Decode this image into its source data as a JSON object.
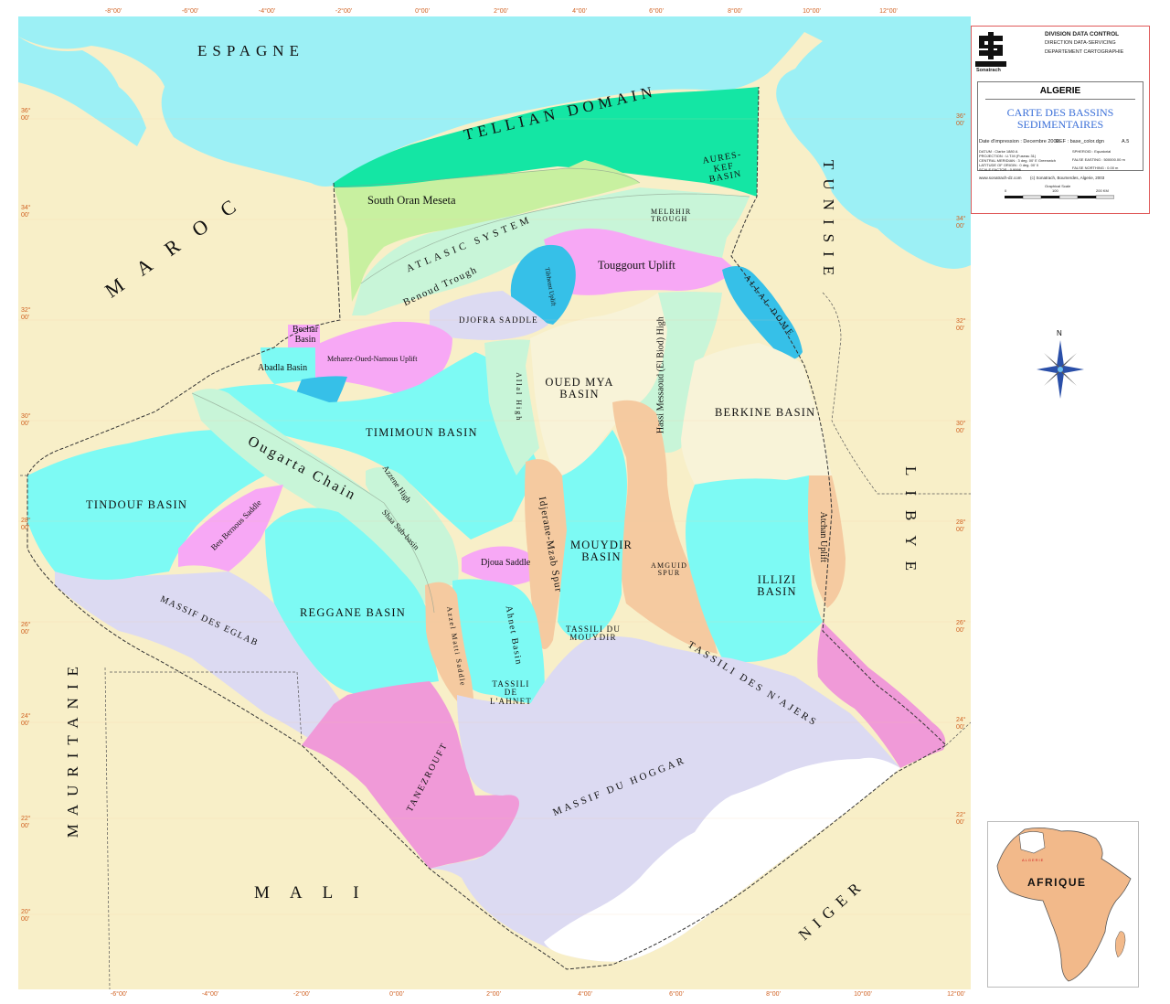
{
  "graticule": {
    "top": [
      "-8°00'",
      "-6°00'",
      "-4°00'",
      "-2°00'",
      "0°00'",
      "2°00'",
      "4°00'",
      "6°00'",
      "8°00'",
      "10°00'",
      "12°00'"
    ],
    "bottom": [
      "-6°00'",
      "-4°00'",
      "-2°00'",
      "0°00'",
      "2°00'",
      "4°00'",
      "6°00'",
      "8°00'",
      "10°00'",
      "12°00'"
    ],
    "left": [
      "36° 00'",
      "34° 00'",
      "32° 00'",
      "30° 00'",
      "28° 00'",
      "26° 00'",
      "24° 00'",
      "22° 00'",
      "20° 00'"
    ],
    "right": [
      "36° 00'",
      "34° 00'",
      "32° 00'",
      "30° 00'",
      "28° 00'",
      "26° 00'",
      "24° 00'",
      "22° 00'"
    ]
  },
  "countries": {
    "espagne": "ESPAGNE",
    "maroc": "MAROC",
    "tunisie": "TUNISIE",
    "libye": "LIBYE",
    "mauritanie": "MAURITANIE",
    "mali": "MALI",
    "niger": "NIGER"
  },
  "regions": {
    "tellian": "TELLIAN DOMAIN",
    "aures_kef": "AURES-KEF BASIN",
    "south_oran": "South Oran Meseta",
    "atlasic": "ATLASIC SYSTEM",
    "melrhir": "MELRHIR TROUGH",
    "touggourt": "Touggourt Uplift",
    "tilrhemt": "Tilrhemt Uplift",
    "benoud": "Benoud Trough",
    "djofra": "DJOFRA SADDLE",
    "allal": "ALLAL DOME",
    "bechar": "Bechar Basin",
    "meharez": "Meharez-Oued-Namous Uplift",
    "abadla": "Abadla Basin",
    "oued_mya": "OUED MYA BASIN",
    "allal_high": "Allal High",
    "hassi_messaoud": "Hassi Messaoud (El Biod) High",
    "berkine": "BERKINE BASIN",
    "timimoun": "TIMIMOUN BASIN",
    "ougarta": "Ougarta Chain",
    "azzene": "Azzene High",
    "tindouf": "TINDOUF BASIN",
    "ben_bernous": "Ben Bernous Saddle",
    "shaa": "Shaa Sub-basin",
    "idjerane": "Idjerane-Mzab Spur",
    "mouydir": "MOUYDIR BASIN",
    "amguid": "AMGUID SPUR",
    "illizi": "ILLIZI BASIN",
    "atchan": "Atchan Uplift",
    "djoua": "Djoua Saddle",
    "reggane": "REGGANE BASIN",
    "massif_eglab": "MASSIF DES EGLAB",
    "azzel_matti": "Azzel Matti Saddle",
    "ahnet": "Ahnet Basin",
    "tassili_mouydir": "TASSILI DU MOUYDIR",
    "tassili_ahnet": "TASSILI DE L'AHNET",
    "tassili_ajjers": "TASSILI DES N'AJERS",
    "tanezrouft": "TANEZROUFT",
    "hoggar": "MASSIF DU HOGGAR"
  },
  "title_block": {
    "org_line1": "DIVISION DATA CONTROL",
    "org_line2": "DIRECTION DATA-SERVICING",
    "org_line3": "DEPARTEMENT CARTOGRAPHIE",
    "logo_text": "Sonatrach",
    "country": "ALGERIE",
    "title_line1": "CARTE DES BASSINS",
    "title_line2": "SEDIMENTAIRES",
    "date": "Date d'impression : Decembre 2003",
    "ref": "REF : base_color.dgn",
    "format": "A.5",
    "datum": "DATUM : Clarke 1880 A",
    "projection": "PROJECTION : U.T.M (Fuseau 31)",
    "central_meridian": "CENTRAL MERIDIAN : 3 deg. 00' E Greenwich",
    "latitude_origin": "LATITUDE OF ORIGIN : 0 deg. 00' 0",
    "scale_factor": "SCALE FACTOR : 0.9996",
    "spheroid": "SPHEROID : Equatorial",
    "false_easting": "FALSE EASTING : 500000.00 m",
    "false_northing": "FALSE NORTHING : 0.00 m",
    "website": "www.sonatrach-dz.com",
    "copyright": "(c) Sonatrach, Boumerdes, Algerie, 2003",
    "graphical_scale": "Graphical Scale",
    "scale_0": "0",
    "scale_100": "100",
    "scale_200": "200 KM"
  },
  "compass": {
    "north": "N"
  },
  "inset": {
    "afrique": "AFRIQUE",
    "algerie": "ALGERIE"
  },
  "colors": {
    "sea": "#9cf0f5",
    "land": "#f8efc8",
    "tellian": "#14e6a4",
    "cyan_basin": "#7dfaf4",
    "pale_green": "#c8f5d8",
    "lime": "#c8f0a0",
    "magenta": "#f7a8f5",
    "blue_dome": "#36c0e8",
    "peach": "#f5caa0",
    "lavender": "#dcdaf2",
    "pink_dark": "#f09ad8",
    "cream": "#f8f3d8"
  }
}
